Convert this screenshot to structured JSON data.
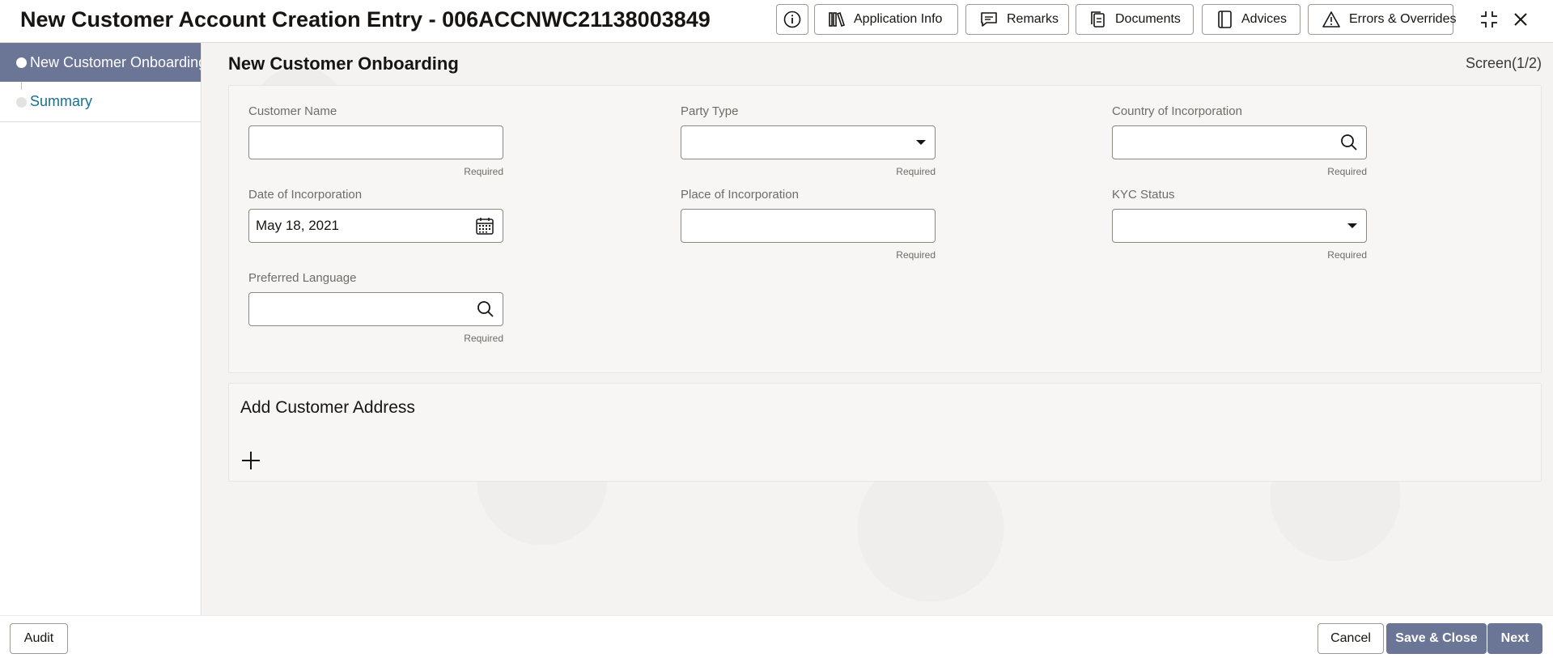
{
  "header": {
    "title": "New Customer Account Creation Entry - 006ACCNWC21138003849",
    "buttons": {
      "info_icon": "info-circle-icon",
      "application_info": "Application Info",
      "remarks": "Remarks",
      "documents": "Documents",
      "advices": "Advices",
      "errors_overrides": "Errors & Overrides"
    }
  },
  "sidebar": {
    "items": [
      {
        "label": "New Customer Onboarding",
        "active": true
      },
      {
        "label": "Summary",
        "active": false
      }
    ]
  },
  "main": {
    "section_title": "New Customer Onboarding",
    "screen_counter": "Screen(1/2)",
    "fields": {
      "customer_name": {
        "label": "Customer Name",
        "value": "",
        "hint": "Required"
      },
      "party_type": {
        "label": "Party Type",
        "value": "",
        "hint": "Required"
      },
      "country_of_incorporation": {
        "label": "Country of Incorporation",
        "value": "",
        "hint": "Required"
      },
      "date_of_incorporation": {
        "label": "Date of Incorporation",
        "value": "May 18, 2021"
      },
      "place_of_incorporation": {
        "label": "Place of Incorporation",
        "value": "",
        "hint": "Required"
      },
      "kyc_status": {
        "label": "KYC Status",
        "value": "",
        "hint": "Required"
      },
      "preferred_language": {
        "label": "Preferred Language",
        "value": "",
        "hint": "Required"
      }
    },
    "address_section": {
      "title": "Add Customer Address"
    }
  },
  "footer": {
    "audit": "Audit",
    "cancel": "Cancel",
    "save_close": "Save & Close",
    "next": "Next"
  },
  "colors": {
    "accent": "#6b7596",
    "link": "#1a6f92",
    "panel_bg": "#f7f6f4"
  }
}
